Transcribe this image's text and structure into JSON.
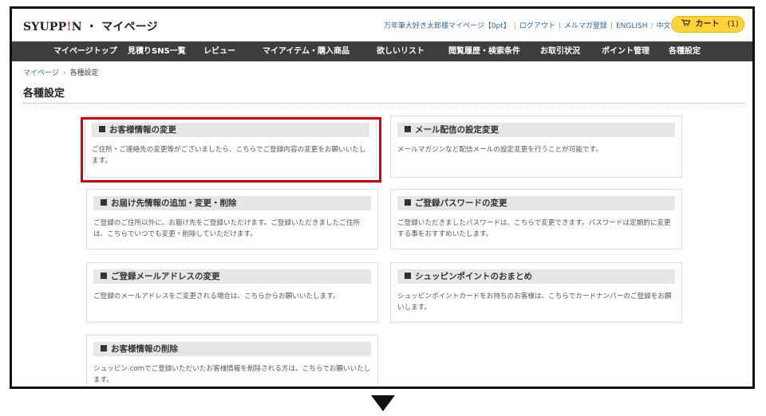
{
  "header": {
    "logo_text": "SYUPP",
    "logo_mark": "!",
    "logo_rest": "N",
    "logo_suffix": " ・ マイページ",
    "user_link": "万年筆大好き太郎様マイページ【0pt】",
    "logout": "ログアウト",
    "newsletter": "メルマガ登録",
    "english": "ENGLISH",
    "chinese": "中文",
    "cart_icon": "cart-icon",
    "cart_label": "カート",
    "cart_count": "(1)"
  },
  "nav": [
    "マイページトップ",
    "見積りSNS一覧",
    "レビュー",
    "マイアイテム・購入商品",
    "欲しいリスト",
    "閲覧履歴・検索条件",
    "お取引状況",
    "ポイント管理",
    "各種設定"
  ],
  "breadcrumb": {
    "home": "マイページ",
    "separator": "›",
    "current": "各種設定"
  },
  "page_title": "各種設定",
  "cards": [
    {
      "title": "お客様情報の変更",
      "desc": "ご住所・ご連絡先の変更等がございましたら、こちらでご登録内容の変更をお願いいたします。"
    },
    {
      "title": "メール配信の設定変更",
      "desc": "メールマガジンなど配信メールの設定変更を行うことが可能です。"
    },
    {
      "title": "お届け先情報の追加・変更・削除",
      "desc": "ご登録のご住所以外に、お届け先をご登録いただけます。ご登録いただきましたご住所は、こちらでいつでも変更・削除していただけます。"
    },
    {
      "title": "ご登録パスワードの変更",
      "desc": "ご登録いただきましたパスワードは、こちらで変更できます。パスワードは定期的に変更する事をおすすめいたします。"
    },
    {
      "title": "ご登録メールアドレスの変更",
      "desc": "ご登録のメールアドレスをご変更される場合は、こちらからお願いいたします。"
    },
    {
      "title": "シュッピンポイントのおまとめ",
      "desc": "シュッピンポイントカードをお持ちのお客様は、こちらでカードナンバーのご登録をお願いします。"
    },
    {
      "title": "お客様情報の削除",
      "desc": "シュッピン.comでご登録いただいたお客様情報を削除される方は、こちらでお願いいたします。"
    }
  ],
  "colors": {
    "accent_red": "#d9000d",
    "nav_bg": "#3d3d3d",
    "link_blue": "#2f63a8",
    "cart_yellow": "#ffd43a"
  }
}
